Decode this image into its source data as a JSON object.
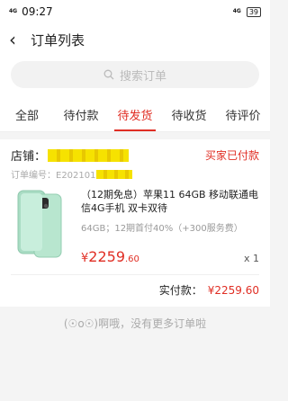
{
  "status_bar": {
    "network": "4G",
    "time": "09:27",
    "network_right": "4G",
    "battery": "39"
  },
  "nav": {
    "title": "订单列表"
  },
  "search": {
    "placeholder": "搜索订单"
  },
  "tabs": [
    {
      "label": "全部",
      "active": false
    },
    {
      "label": "待付款",
      "active": false
    },
    {
      "label": "待发货",
      "active": true
    },
    {
      "label": "待收货",
      "active": false
    },
    {
      "label": "待评价",
      "active": false
    }
  ],
  "order": {
    "shop_label": "店铺：",
    "status": "买家已付款",
    "order_no_label": "订单编号：E202101",
    "product": {
      "name": "（12期免息）苹果11 64GB 移动联通电信4G手机 双卡双待",
      "spec": "64GB；12期首付40%（+300服务费）",
      "price_currency": "¥",
      "price_int": "2259",
      "price_dec": ".60",
      "qty": "x 1"
    },
    "total_label": "实付款：",
    "total_value": "¥2259.60"
  },
  "footer": {
    "face": "(☉o☉)",
    "text": "啊哦，没有更多订单啦"
  },
  "colors": {
    "accent": "#e02e24",
    "background": "#f4f4f4",
    "phone_green": "#b8e6cf"
  }
}
